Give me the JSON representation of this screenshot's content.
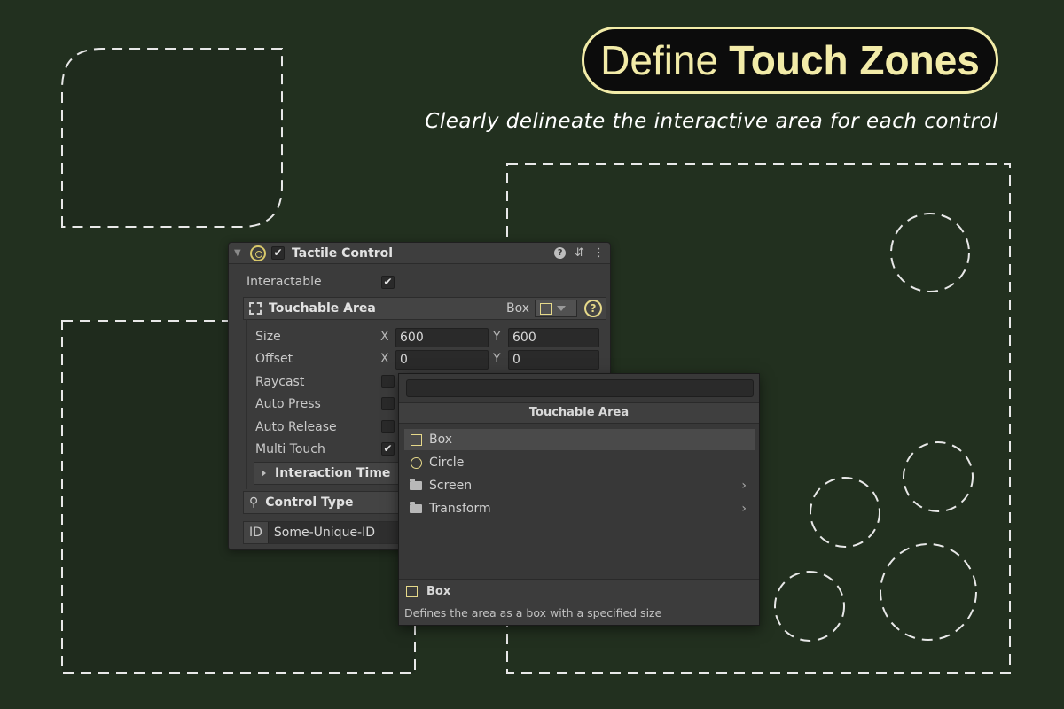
{
  "headline": {
    "regular": "Define",
    "bold": "Touch Zones"
  },
  "subheadline": "Clearly delineate the interactive area for each control",
  "colors": {
    "background": "#22301f",
    "accent": "#f2eba8",
    "dash": "#e8e8e8",
    "panel": "#3b3b3b"
  },
  "inspector": {
    "title": "Tactile Control",
    "enabled_check": "✔",
    "header_icons": [
      "help-icon",
      "preset-icon",
      "more-icon"
    ],
    "interactable": {
      "label": "Interactable",
      "checked": "✔"
    },
    "touchable_area": {
      "title": "Touchable Area",
      "shape_value": "Box",
      "help": "?",
      "size": {
        "label": "Size",
        "x_label": "X",
        "x": "600",
        "y_label": "Y",
        "y": "600"
      },
      "offset": {
        "label": "Offset",
        "x_label": "X",
        "x": "0",
        "y_label": "Y",
        "y": "0"
      },
      "raycast": {
        "label": "Raycast"
      },
      "auto_press": {
        "label": "Auto Press"
      },
      "auto_release": {
        "label": "Auto Release"
      },
      "multi_touch": {
        "label": "Multi Touch",
        "checked": "✔"
      },
      "interaction_time": "Interaction Time"
    },
    "control_type": {
      "title": "Control Type"
    },
    "id": {
      "label": "ID",
      "value": "Some-Unique-ID"
    }
  },
  "popup": {
    "search_value": "",
    "header": "Touchable Area",
    "items": [
      {
        "label": "Box",
        "icon": "square-icon"
      },
      {
        "label": "Circle",
        "icon": "circle-icon"
      },
      {
        "label": "Screen",
        "icon": "folder-icon",
        "chevron": "›"
      },
      {
        "label": "Transform",
        "icon": "folder-icon",
        "chevron": "›"
      }
    ],
    "footer": {
      "title": "Box",
      "description": "Defines the area as a box with a specified size"
    }
  }
}
